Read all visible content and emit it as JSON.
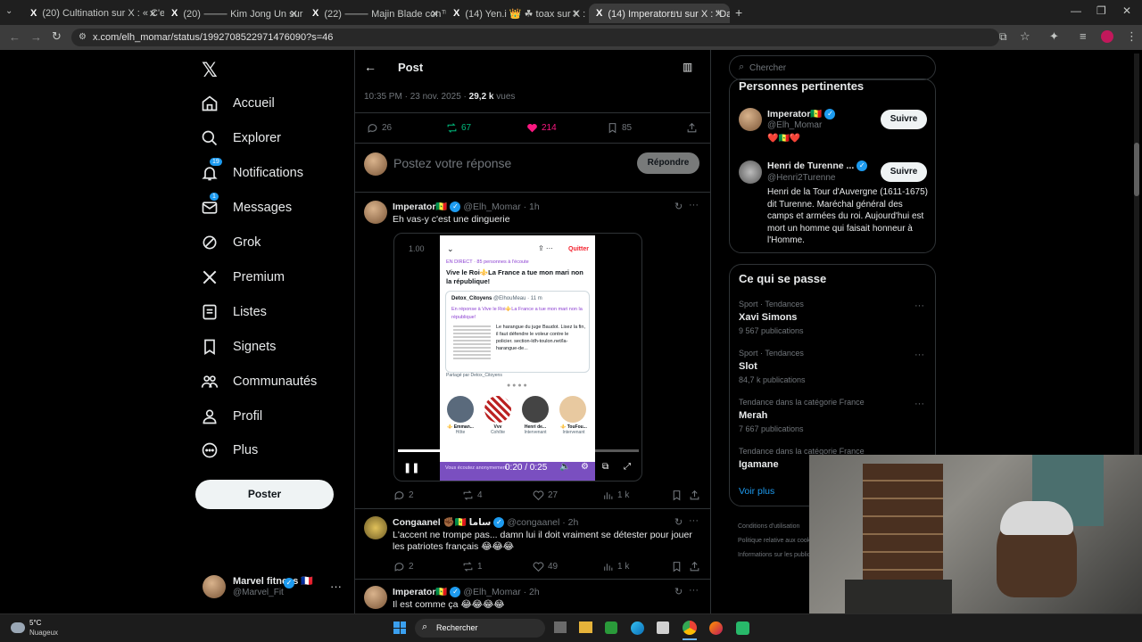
{
  "browser": {
    "tabs": [
      {
        "label": "(20) Cultination sur X : « C'est"
      },
      {
        "label": "(20) ⸻ Kim Jong Un sur X : \""
      },
      {
        "label": "(22) ⸻ Majin Blade con™ sur X : "
      },
      {
        "label": "(14) Yen.i 👑 ☘ toax sur X : \"V"
      },
      {
        "label": "(14) Imperatorยบ sur X : \"Da"
      }
    ],
    "url": "x.com/elh_momar/status/1992708522971476090?s=46"
  },
  "nav": {
    "items": [
      {
        "label": "Accueil"
      },
      {
        "label": "Explorer"
      },
      {
        "label": "Notifications",
        "badge": "19"
      },
      {
        "label": "Messages",
        "badge": "1"
      },
      {
        "label": "Grok"
      },
      {
        "label": "Premium"
      },
      {
        "label": "Listes"
      },
      {
        "label": "Signets"
      },
      {
        "label": "Communautés"
      },
      {
        "label": "Profil"
      },
      {
        "label": "Plus"
      }
    ],
    "post_button": "Poster",
    "account": {
      "name": "Marvel fitness 🇫🇷",
      "handle": "@Marvel_Fit"
    }
  },
  "header": {
    "title": "Post"
  },
  "post": {
    "timestamp": "10:35 PM · 23 nov. 2025 · ",
    "views": "29,2 k",
    "views_label": "vues",
    "replies": "26",
    "reposts": "67",
    "likes": "214",
    "bookmarks": "85"
  },
  "composer": {
    "placeholder": "Postez votre réponse",
    "reply_button": "Répondre"
  },
  "replies": [
    {
      "name": "Imperator🇸🇳",
      "handle": "@Elh_Momar · 1h",
      "text": "Eh vas-y c'est une dinguerie",
      "replies": "2",
      "reposts": "4",
      "likes": "27",
      "views": "1 k"
    },
    {
      "name": "Congaanel ✊🏾🇸🇳 ساما",
      "handle": "@congaanel · 2h",
      "text": "L'accent ne trompe pas... damn lui il doit vraiment se détester pour jouer les patriotes français 😂😂😂",
      "replies": "2",
      "reposts": "1",
      "likes": "49",
      "views": "1 k"
    },
    {
      "name": "Imperator🇸🇳",
      "handle": "@Elh_Momar · 2h",
      "text": "Il est comme ça 😂😂😂😂"
    }
  ],
  "video": {
    "time": "0:20 / 0:25",
    "progress": 0.8,
    "speed": "1.00",
    "inner": {
      "live": "EN DIRECT · 85 personnes à l'écoute",
      "quit": "Quitter",
      "title": "Vive le Roi⚜️La France a tue mon mari non la république!",
      "quoted_author": "Detox_Citoyens",
      "quoted_handle": "@ElhouMeau · 11 m",
      "quoted_reply": "En réponse à Vive le Roi⚜️La France a tue mon mari non la république!",
      "quoted_text": "Le harangue du juge Baudot. Lisez la fin, il faut défendre le voleur contre le policier. section-ldh-toulon.net/la-harangue-de...",
      "shared_by": "Partagé par Detox_Citoyens",
      "speakers": [
        {
          "name": "⚜️ Emman...",
          "role": "Hôte"
        },
        {
          "name": "Vvv",
          "role": "Cohôte"
        },
        {
          "name": "Henri de...",
          "role": "Intervenant"
        },
        {
          "name": "⚜️ TouFou...",
          "role": "Intervenant"
        }
      ],
      "bottom": "Vous écoutez anonymement"
    }
  },
  "search": {
    "placeholder": "Chercher"
  },
  "relevant": {
    "title": "Personnes pertinentes",
    "people": [
      {
        "name": "Imperator🇸🇳",
        "handle": "@Elh_Momar",
        "bio": "❤️🇸🇳❤️",
        "follow": "Suivre"
      },
      {
        "name": "Henri de Turenne ...",
        "handle": "@Henri2Turenne",
        "bio": "Henri de la Tour d'Auvergne (1611-1675) dit Turenne. Maréchal général des camps et armées du roi. Aujourd'hui est mort un homme qui faisait honneur à l'Homme.",
        "follow": "Suivre"
      }
    ]
  },
  "trends": {
    "title": "Ce qui se passe",
    "items": [
      {
        "category": "Sport · Tendances",
        "name": "Xavi Simons",
        "count": "9 567 publications"
      },
      {
        "category": "Sport · Tendances",
        "name": "Slot",
        "count": "84,7 k publications"
      },
      {
        "category": "Tendance dans la catégorie France",
        "name": "Merah",
        "count": "7 667 publications"
      },
      {
        "category": "Tendance dans la catégorie France",
        "name": "Igamane",
        "count": ""
      }
    ],
    "see_more": "Voir plus"
  },
  "footer_links": [
    "Conditions d'utilisation",
    "Politique relative aux cookies",
    "Informations sur les publicités"
  ],
  "taskbar": {
    "weather_temp": "5°C",
    "weather_desc": "Nuageux",
    "search": "Rechercher"
  },
  "colors": {
    "accent": "#1d9bf0",
    "like": "#f91880",
    "repost": "#00ba7c"
  }
}
